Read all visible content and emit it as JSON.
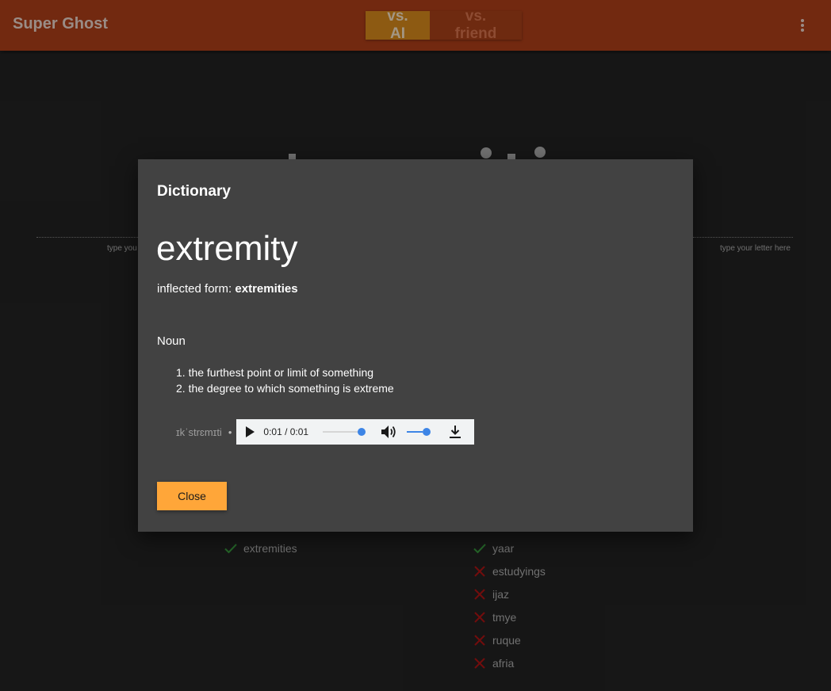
{
  "app": {
    "title": "Super Ghost",
    "modes": [
      "vs. AI",
      "vs. friend"
    ],
    "active_mode": "vs. AI",
    "menu_icon": "kebab-menu-icon"
  },
  "game": {
    "hint_left": "type you",
    "hint_right": "type your letter here",
    "left_words": [
      {
        "word": "extremities",
        "valid": true
      }
    ],
    "right_words": [
      {
        "word": "yaar",
        "valid": true
      },
      {
        "word": "estudyings",
        "valid": false
      },
      {
        "word": "ijaz",
        "valid": false
      },
      {
        "word": "tmye",
        "valid": false
      },
      {
        "word": "ruque",
        "valid": false
      },
      {
        "word": "afria",
        "valid": false
      }
    ]
  },
  "dictionary": {
    "heading": "Dictionary",
    "headword": "extremity",
    "inflected_label": "inflected form:",
    "inflected_value": "extremities",
    "part_of_speech": "Noun",
    "senses": [
      "1. the furthest point or limit of something",
      "2. the degree to which something is extreme"
    ],
    "pronunciation": "ɪkˈstrɛmɪti",
    "bullet": "•",
    "audio": {
      "time": "0:01 / 0:01",
      "seek_progress": 1.0,
      "volume_level": 0.67,
      "icons": [
        "play-icon",
        "volume-icon",
        "download-icon"
      ]
    },
    "close_label": "Close"
  },
  "colors": {
    "appbar": "#722910",
    "accent_button": "#ffa639",
    "modal_bg": "#424242",
    "valid_check": "#2e7d32",
    "invalid_x": "#8b0f0f",
    "audio_accent": "#3d85e6"
  }
}
